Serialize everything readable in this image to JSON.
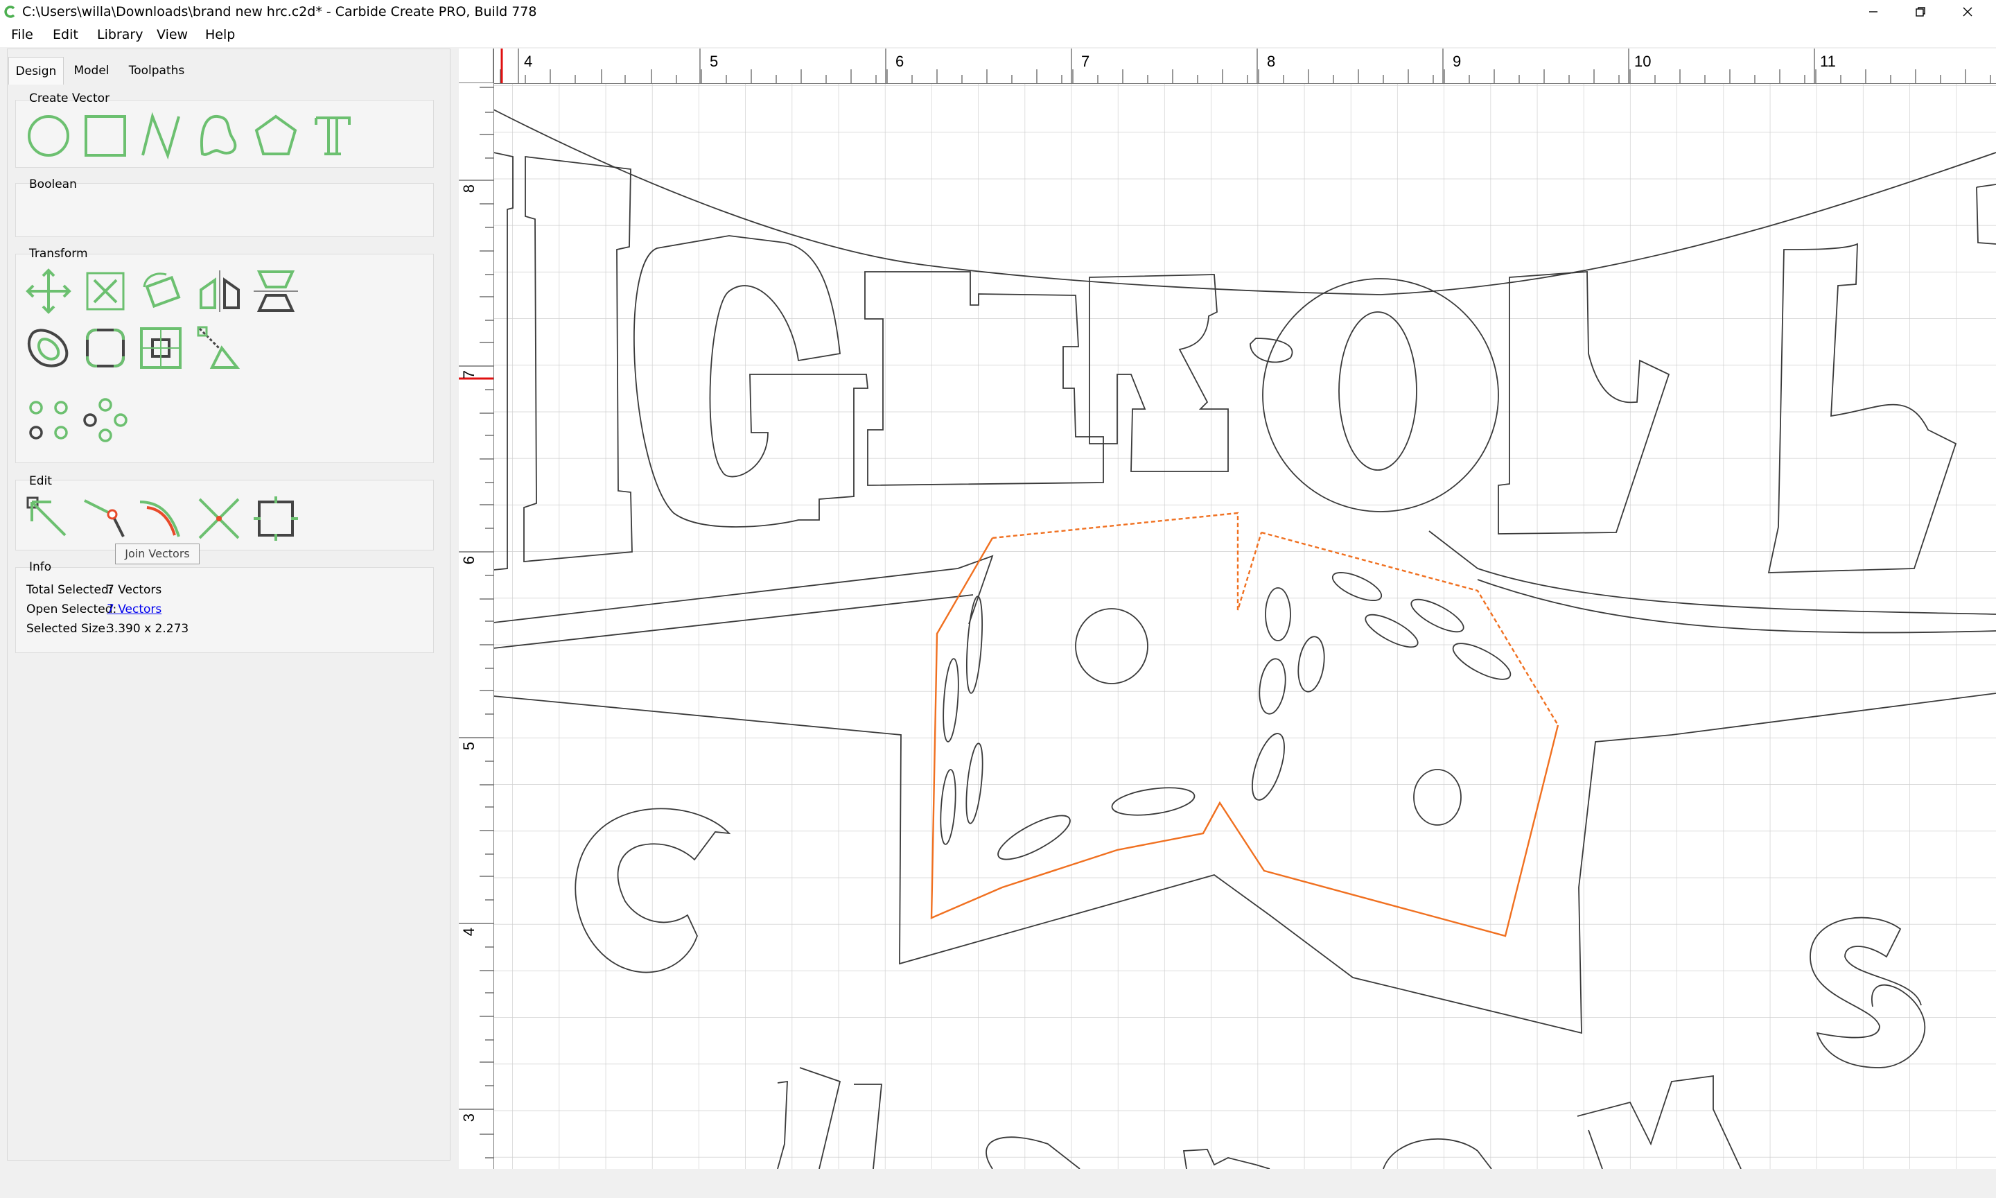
{
  "window": {
    "title": "C:\\Users\\willa\\Downloads\\brand new hrc.c2d* - Carbide Create PRO, Build 778",
    "accent_color": "#6cc070",
    "selection_color": "#f07020"
  },
  "menu": [
    {
      "label": "File"
    },
    {
      "label": "Edit"
    },
    {
      "label": "Library"
    },
    {
      "label": "View"
    },
    {
      "label": "Help"
    }
  ],
  "tabs": [
    {
      "label": "Design",
      "active": true
    },
    {
      "label": "Model",
      "active": false
    },
    {
      "label": "Toolpaths",
      "active": false
    }
  ],
  "groups": {
    "create_vector": "Create Vector",
    "boolean": "Boolean",
    "transform": "Transform",
    "edit": "Edit",
    "info": "Info"
  },
  "tooltip": "Join Vectors",
  "info": {
    "total_selected_label": "Total Selected:",
    "total_selected_value": "7 Vectors",
    "open_selected_label": "Open Selected:",
    "open_selected_value": "7 Vectors",
    "selected_size_label": "Selected Size:",
    "selected_size_value": "3.390 x 2.273"
  },
  "ruler": {
    "x_labels": [
      "4",
      "5",
      "6",
      "7",
      "8",
      "9",
      "10",
      "11"
    ],
    "y_labels": [
      "8",
      "7",
      "6",
      "5",
      "4",
      "3"
    ]
  }
}
